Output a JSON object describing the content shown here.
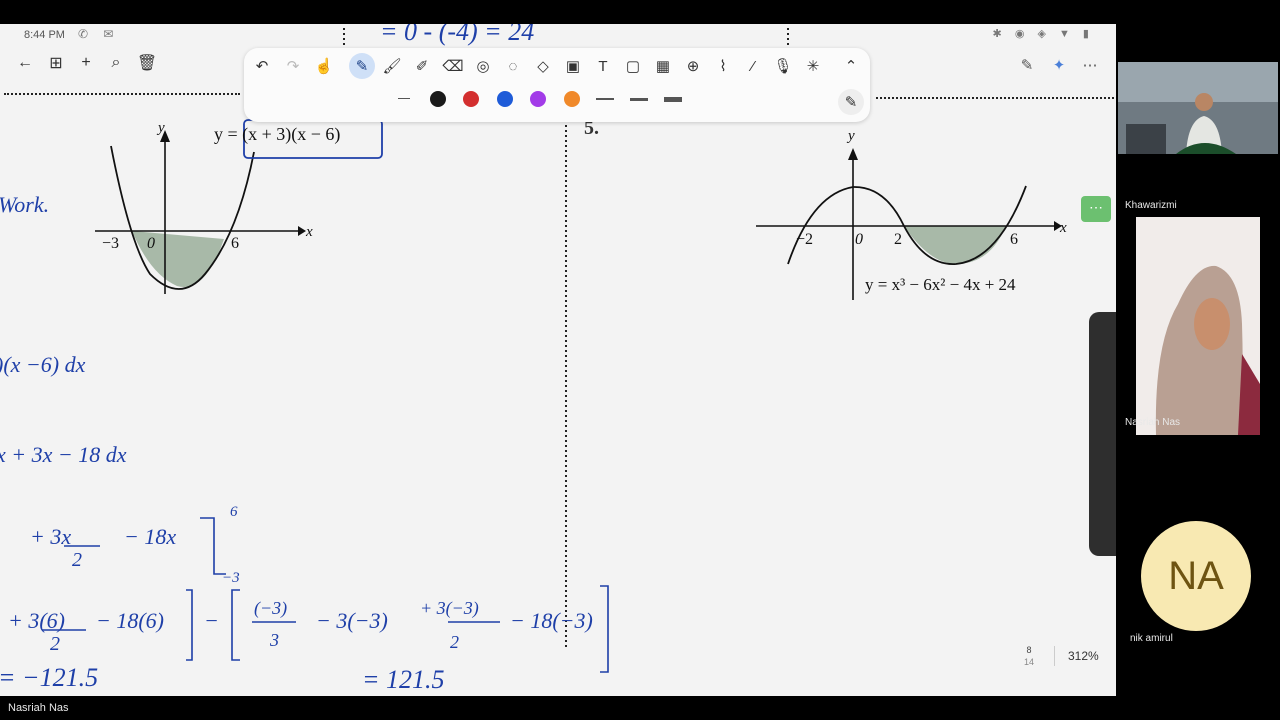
{
  "status_bar": {
    "time": "8:44 PM"
  },
  "toolbar": {
    "colors": [
      "#1a1a1a",
      "#d32f2f",
      "#1e5bd8",
      "#a23be8",
      "#f0892a"
    ]
  },
  "canvas": {
    "top_ink": "= 0 - (-4) = 24",
    "left_problem": {
      "curve_label": "y = (x + 3)(x − 6)",
      "axis_x": "x",
      "axis_y": "y",
      "tick_neg3": "−3",
      "tick_0": "0",
      "tick_6": "6",
      "note": "Work."
    },
    "right_problem": {
      "number": "5.",
      "curve_label": "y = x³ − 6x² − 4x + 24",
      "axis_x": "x",
      "axis_y": "y",
      "tick_neg2": "−2",
      "tick_0": "0",
      "tick_2": "2",
      "tick_6": "6"
    },
    "handwriting": {
      "line1": ")(x −6)  dx",
      "line2": "x + 3x − 18   dx",
      "line3_a": "+ 3x",
      "line3_b": "2",
      "line3_c": "− 18x",
      "limit_upper": "6",
      "limit_lower": "−3",
      "line4_a": "+ 3(6)",
      "line4_b": "2",
      "line4_c": "− 18(6)",
      "line4_d": "(−3)",
      "line4_e": "3",
      "line4_f": "− 3(−3)",
      "line4_g": "+ 3(−3)",
      "line4_h": "2",
      "line4_i": "− 18(−3)",
      "result_left": "= −121.5",
      "result_right": "= 121.5"
    }
  },
  "page_indicator": {
    "current": "8",
    "total": "14",
    "zoom": "312%"
  },
  "participants": [
    {
      "name": "Khawarizmi"
    },
    {
      "name": "Nasriah  Nas"
    },
    {
      "name": "nik amirul",
      "initials": "NA"
    }
  ],
  "bottom_bar": {
    "speaker": "Nasriah  Nas"
  }
}
